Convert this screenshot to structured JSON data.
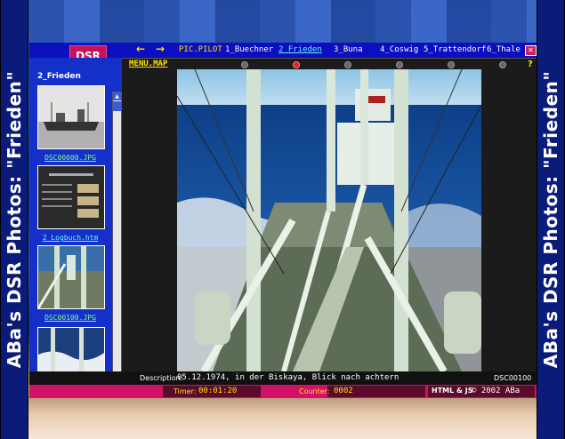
{
  "side_title": "ABa's DSR Photos: \"Frieden\"",
  "logo": "DSR",
  "nav": {
    "back_arrow": "←",
    "forward_arrow": "→",
    "links": [
      "PIC.PILOT",
      "1_Buechner",
      "2_Frieden",
      "3_Buna",
      "4_Coswig",
      "5_Trattendorf",
      "6_Thale"
    ],
    "close": "✕"
  },
  "menu_map": "MENU.MAP",
  "help": "?",
  "left_pane": {
    "title": "2_Frieden",
    "thumbnails": [
      {
        "label": "DSC00000.JPG"
      },
      {
        "label": "2_Logbuch.htm"
      },
      {
        "label": "DSC00100.JPG"
      },
      {
        "label": ""
      }
    ]
  },
  "caption": {
    "label": "Description:",
    "text": "05.12.1974,  in der Biskaya, Blick nach achtern",
    "filename": "DSC00100"
  },
  "status": {
    "timer_label": "Timer:",
    "timer_value": "00:01:20",
    "counter_label": "Counter:",
    "counter_value": "0002",
    "tech": "HTML & JS",
    "copyright": "© 2002 ABa"
  },
  "colors": {
    "frame_blue": "#0a1a9e",
    "magenta": "#d0126a",
    "accent_yellow": "#ffe400",
    "link_green": "#7dff7d"
  }
}
